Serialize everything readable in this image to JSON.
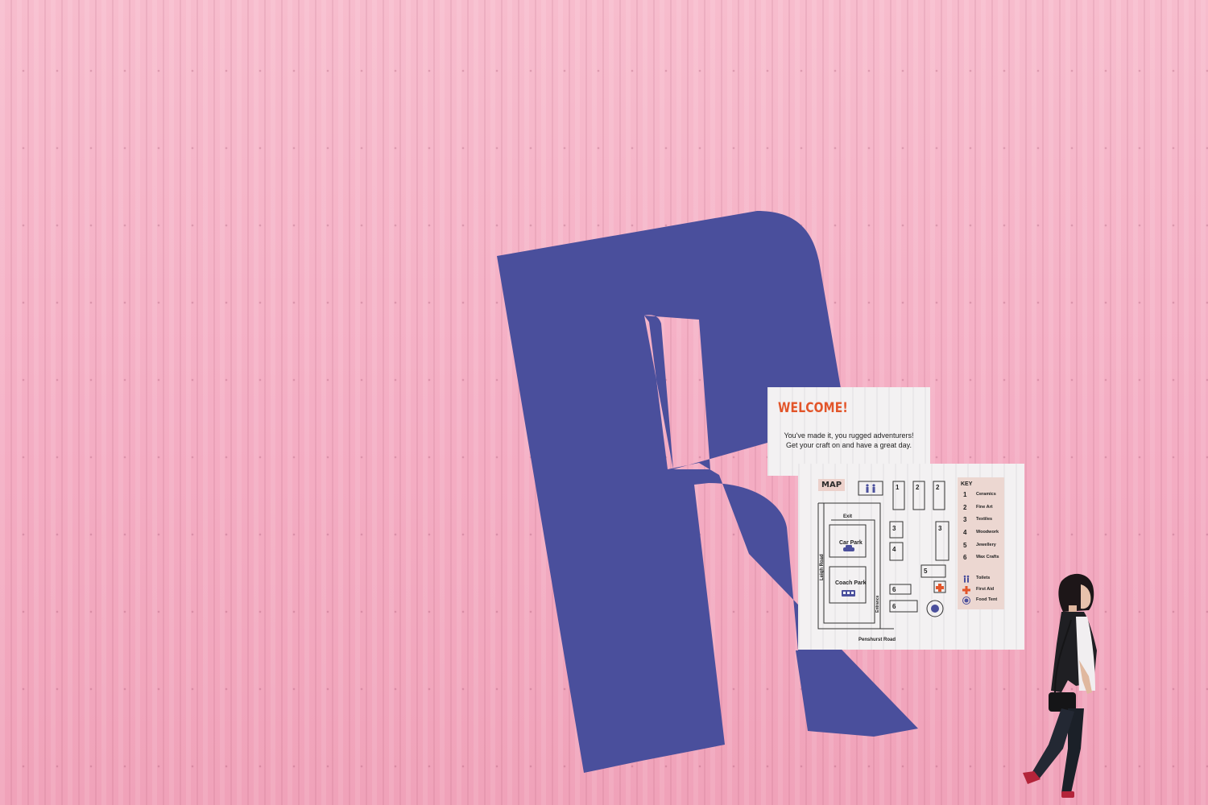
{
  "welcome_sign": {
    "title": "WELCOME!",
    "line1": "You've made it, you rugged adventurers!",
    "line2": "Get your craft on and have a great day."
  },
  "map_sign": {
    "title": "MAP",
    "roads": {
      "exit": "Exit",
      "leigh_road": "Leigh Road",
      "car_park": "Car Park",
      "coach_park": "Coach Park",
      "entrance": "Entrance",
      "penshurst_road": "Penshurst Road"
    },
    "stall_numbers": [
      "1",
      "2",
      "2",
      "3",
      "3",
      "4",
      "5",
      "6",
      "6"
    ],
    "key": {
      "title": "KEY",
      "items": [
        {
          "num": "1",
          "label": "Ceramics"
        },
        {
          "num": "2",
          "label": "Fine Art"
        },
        {
          "num": "3",
          "label": "Textiles"
        },
        {
          "num": "4",
          "label": "Woodwork"
        },
        {
          "num": "5",
          "label": "Jewellery"
        },
        {
          "num": "6",
          "label": "Wax Crafts"
        }
      ],
      "facilities": [
        {
          "icon": "toilets-icon",
          "label": "Toilets"
        },
        {
          "icon": "first-aid-icon",
          "label": "First Aid"
        },
        {
          "icon": "food-tent-icon",
          "label": "Food Tent"
        }
      ]
    }
  },
  "colors": {
    "wall_pink": "#f6b4c8",
    "letter_blue": "#4a4f9c",
    "accent_orange": "#e2552a",
    "key_panel": "#ecd7d1"
  }
}
